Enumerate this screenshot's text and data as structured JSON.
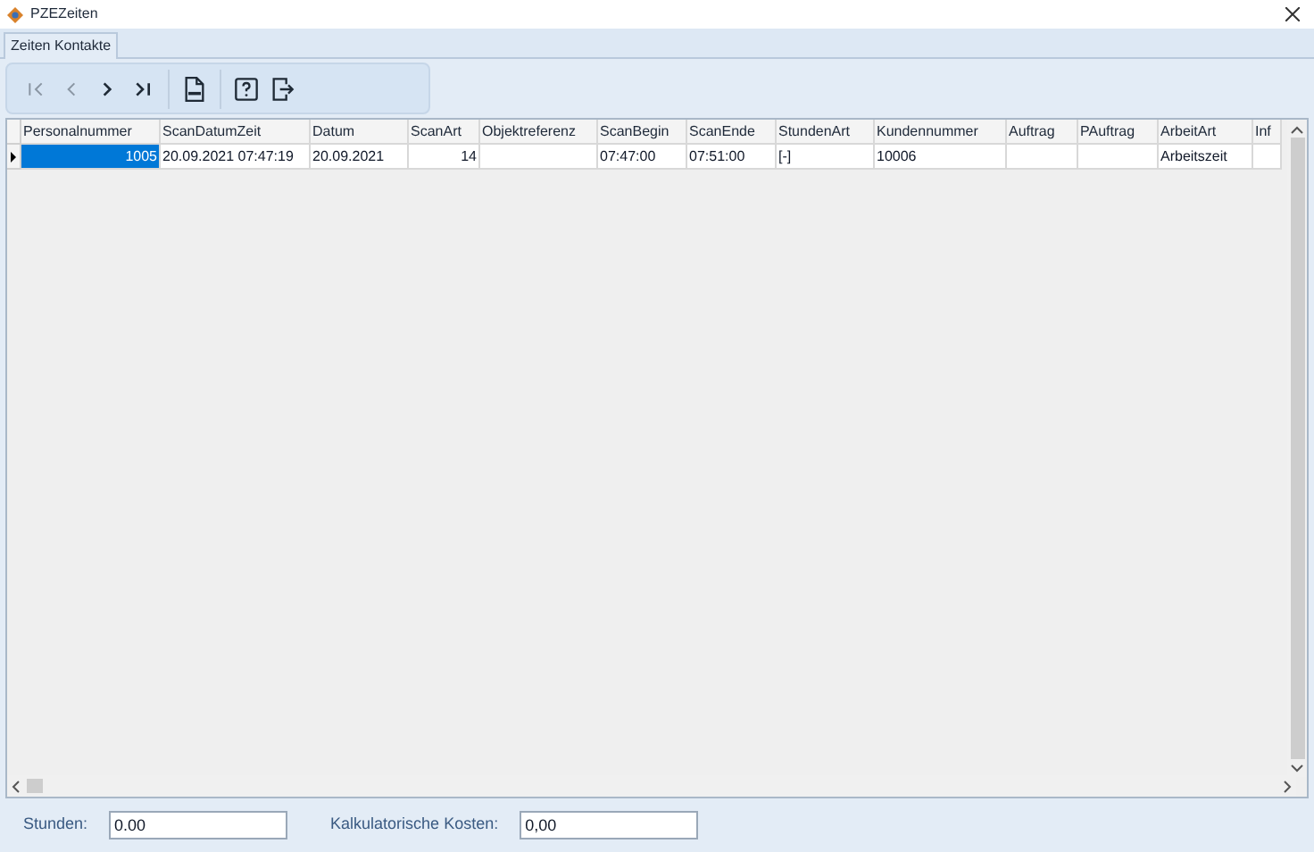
{
  "window": {
    "title": "PZEZeiten"
  },
  "tabs": [
    {
      "label": "Zeiten Kontakte",
      "selected": true
    }
  ],
  "toolbar": [
    {
      "kind": "first",
      "disabled": true
    },
    {
      "kind": "prev",
      "disabled": true
    },
    {
      "kind": "next",
      "disabled": false
    },
    {
      "kind": "last",
      "disabled": false
    },
    {
      "kind": "xls",
      "disabled": false
    },
    {
      "kind": "help",
      "disabled": false
    },
    {
      "kind": "exit",
      "disabled": false
    }
  ],
  "table": {
    "columns": [
      {
        "label": "Personalnummer",
        "kind": "number"
      },
      {
        "label": "ScanDatumZeit",
        "kind": "text"
      },
      {
        "label": "Datum",
        "kind": "text"
      },
      {
        "label": "ScanArt",
        "kind": "number"
      },
      {
        "label": "Objektreferenz",
        "kind": "text"
      },
      {
        "label": "ScanBegin",
        "kind": "text"
      },
      {
        "label": "ScanEnde",
        "kind": "text"
      },
      {
        "label": "StundenArt",
        "kind": "text"
      },
      {
        "label": "Kundennummer",
        "kind": "text"
      },
      {
        "label": "Auftrag",
        "kind": "text"
      },
      {
        "label": "PAuftrag",
        "kind": "text"
      },
      {
        "label": "ArbeitArt",
        "kind": "text"
      },
      {
        "label": "Inf",
        "kind": "text"
      }
    ],
    "rows": [
      {
        "selected": true,
        "cells": [
          "1005",
          "20.09.2021 07:47:19",
          "20.09.2021",
          "14",
          "",
          "07:47:00",
          "07:51:00",
          "[-]",
          "10006",
          "",
          "",
          "Arbeitszeit",
          ""
        ]
      }
    ]
  },
  "footer": {
    "fields": [
      {
        "label": "Stunden:",
        "value": "0.00"
      },
      {
        "label": "Kalkulatorische Kosten:",
        "value": "0,00"
      }
    ]
  }
}
